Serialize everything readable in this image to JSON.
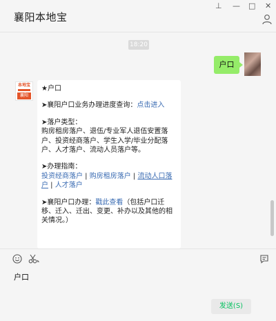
{
  "window": {
    "title": "襄阳本地宝",
    "controls": [
      "⊥",
      "—",
      "□",
      "✕"
    ]
  },
  "chat": {
    "timestamp": "18:20",
    "my_message": "户口",
    "bot_avatar": {
      "top": "本地宝",
      "bottom": "襄阳"
    },
    "bot_message": {
      "heading": "★户口",
      "progress_prefix": "➤襄阳户口业务办理进度查询：",
      "progress_link": "点击进入",
      "types_title": "➤落户类型：",
      "types_text": "购房租房落户、退伍/专业军人退伍安置落户、投资经商落户、学生入学/毕业分配落户、人才落户、流动人员落户等。",
      "guide_title": "➤办理指南：",
      "guide_links": [
        "投资经商落户",
        "购房租房落户",
        "流动人口落户",
        "人才落户"
      ],
      "separator": " | ",
      "handle_prefix": "➤襄阳户口办理：",
      "handle_link": "戳此查看",
      "handle_text": "（包括户口迁移、迁入、迁出、变更、补办以及其他的相关情况。）"
    }
  },
  "composer": {
    "input_value": "户口",
    "send_label": "发送(S)"
  },
  "colors": {
    "my_bubble": "#95ec69",
    "link": "#3b6cb3",
    "send_text": "#07c160"
  }
}
